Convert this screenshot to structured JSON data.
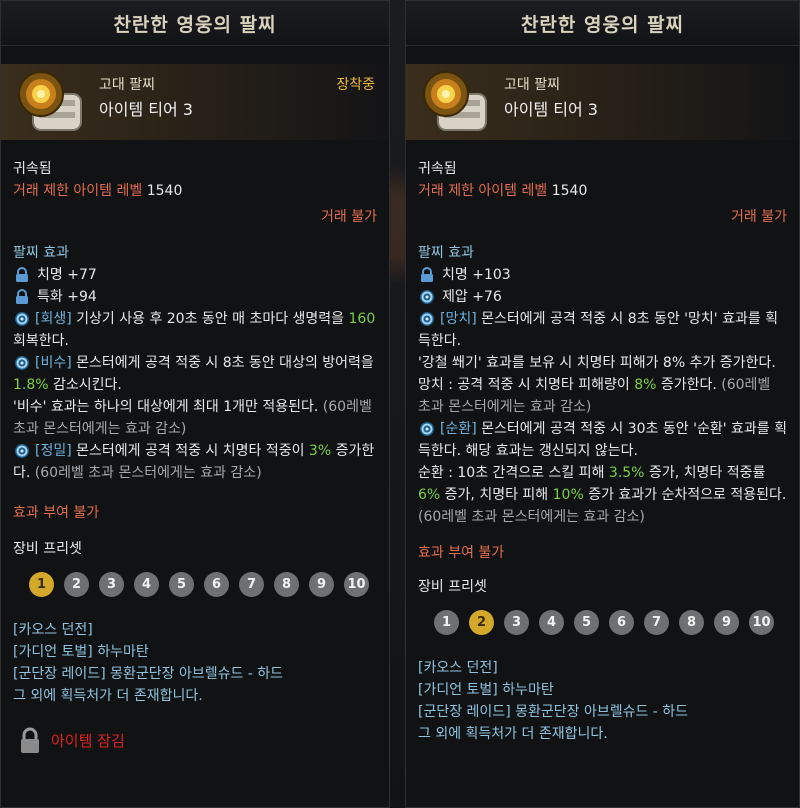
{
  "panels": [
    {
      "title": "찬란한 영웅의 팔찌",
      "grade": "고대 팔찌",
      "tier": "아이템 티어 3",
      "equipped": "장착중",
      "bound": "귀속됨",
      "level_label": "거래 제한 아이템 레벨",
      "level_value": "1540",
      "trade": "거래 불가",
      "effects_title": "팔찌 효과",
      "stats": [
        {
          "icon": "lock-icon",
          "text": "치명 +77"
        },
        {
          "icon": "lock-icon",
          "text": "특화 +94"
        }
      ],
      "effect1": {
        "tag": "[회생]",
        "a": " 기상기 사용 후 20초 동안 매 초마다 생명력을 ",
        "num": "160",
        "b": " 회복한다."
      },
      "effect2": {
        "tag": "[비수]",
        "a": " 몬스터에게 공격 적중 시 8초 동안 대상의 방어력을 ",
        "num": "1.8%",
        "b": " 감소시킨다.",
        "c": "'비수' 효과는 하나의 대상에게 최대 1개만 적용된다.",
        "d": " (60레벨 초과 몬스터에게는 효과 감소)"
      },
      "effect3": {
        "tag": "[정밀]",
        "a": " 몬스터에게 공격 적중 시 치명타 적중이 ",
        "num": "3%",
        "b": " 증가한다.",
        "d": " (60레벨 초과 몬스터에게는 효과 감소)"
      },
      "no_grant": "효과 부여 불가",
      "preset_title": "장비 프리셋",
      "presets": [
        "1",
        "2",
        "3",
        "4",
        "5",
        "6",
        "7",
        "8",
        "9",
        "10"
      ],
      "sources": [
        "[카오스 던전]",
        "[가디언 토벌] 하누마탄",
        "[군단장 레이드] 몽환군단장 아브렐슈드 - 하드",
        "그 외에 획득처가 더 존재합니다."
      ],
      "lock_text": "아이템 잠김"
    },
    {
      "title": "찬란한 영웅의 팔찌",
      "grade": "고대 팔찌",
      "tier": "아이템 티어 3",
      "bound": "귀속됨",
      "level_label": "거래 제한 아이템 레벨",
      "level_value": "1540",
      "trade": "거래 불가",
      "effects_title": "팔찌 효과",
      "stats": [
        {
          "icon": "lock-icon",
          "text": "치명 +103"
        },
        {
          "icon": "swirl-icon",
          "text": "제압 +76"
        }
      ],
      "effect1": {
        "tag": "[망치]",
        "a": " 몬스터에게 공격 적중 시 8초 동안 '망치' 효과를 획득한다.",
        "b": "'강철 쐐기' 효과를 보유 시 치명타 피해가 8% 추가 증가한다.",
        "c": "망치 : 공격 적중 시 치명타 피해량이 ",
        "num": "8%",
        "d": " 증가한다.",
        "e": " (60레벨 초과 몬스터에게는 효과 감소)"
      },
      "effect2": {
        "tag": "[순환]",
        "a": " 몬스터에게 공격 적중 시 30초 동안 '순환' 효과를 획득한다. 해당 효과는 갱신되지 않는다.",
        "b": "순환 : 10초 간격으로 스킬 피해 ",
        "num1": "3.5%",
        "c": " 증가, 치명타 적중률 ",
        "num2": "6%",
        "d": " 증가, 치명타 피해 ",
        "num3": "10%",
        "e": " 증가 효과가 순차적으로 적용된다.",
        "f": " (60레벨 초과 몬스터에게는 효과 감소)"
      },
      "no_grant": "효과 부여 불가",
      "preset_title": "장비 프리셋",
      "presets": [
        "1",
        "2",
        "3",
        "4",
        "5",
        "6",
        "7",
        "8",
        "9",
        "10"
      ],
      "sources": [
        "[카오스 던전]",
        "[가디언 토벌] 하누마탄",
        "[군단장 레이드] 몽환군단장 아브렐슈드 - 하드",
        "그 외에 획득처가 더 존재합니다."
      ]
    }
  ]
}
